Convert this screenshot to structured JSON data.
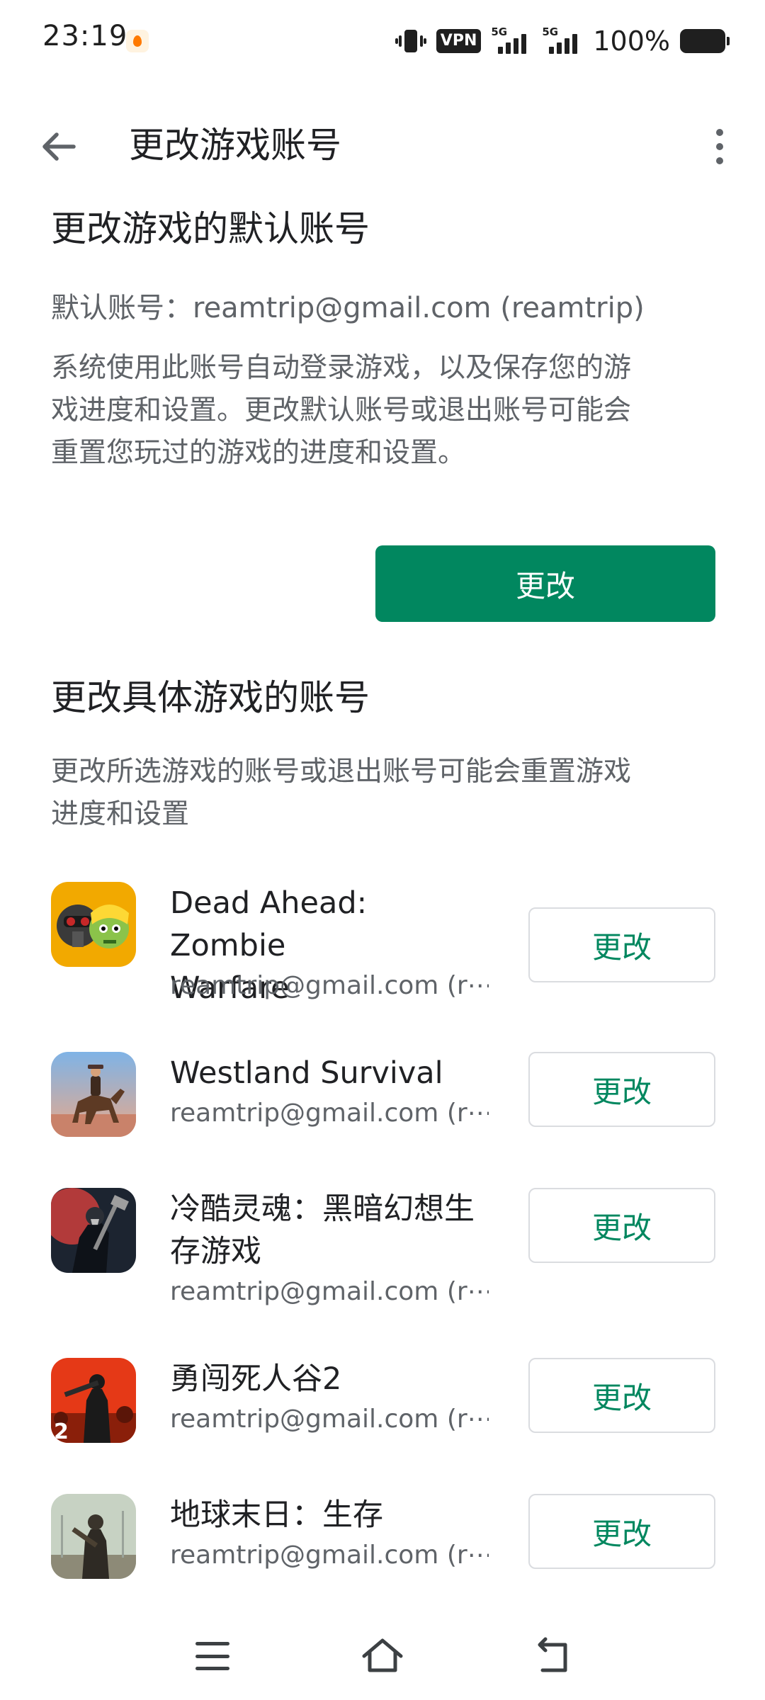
{
  "status_bar": {
    "time": "23:19",
    "vpn": "VPN",
    "network1": "5G",
    "network2": "5G",
    "battery": "100%"
  },
  "app_bar": {
    "title": "更改游戏账号"
  },
  "default_section": {
    "title": "更改游戏的默认账号",
    "account_line": "默认账号：reamtrip@gmail.com (reamtrip)",
    "description_lines": [
      "系统使用此账号自动登录游戏，以及保存您的游",
      "戏进度和设置。更改默认账号或退出账号可能会",
      "重置您玩过的游戏的进度和设置。"
    ],
    "change_button": "更改"
  },
  "specific_section": {
    "title": "更改具体游戏的账号",
    "description_lines": [
      "更改所选游戏的账号或退出账号可能会重置游戏",
      "进度和设置"
    ]
  },
  "games": [
    {
      "name_lines": [
        "Dead Ahead: Zombie",
        "Warfare"
      ],
      "account": "reamtrip@gmail.com (r⋯",
      "button": "更改",
      "icon": "dead-ahead-icon"
    },
    {
      "name_lines": [
        "Westland Survival"
      ],
      "account": "reamtrip@gmail.com (r⋯",
      "button": "更改",
      "icon": "westland-survival-icon"
    },
    {
      "name_lines": [
        "冷酷灵魂：黑暗幻想生",
        "存游戏"
      ],
      "account": "reamtrip@gmail.com (r⋯",
      "button": "更改",
      "icon": "grim-soul-icon"
    },
    {
      "name_lines": [
        "勇闯死人谷2"
      ],
      "account": "reamtrip@gmail.com (r⋯",
      "button": "更改",
      "icon": "into-the-dead-2-icon"
    },
    {
      "name_lines": [
        "地球末日：生存"
      ],
      "account": "reamtrip@gmail.com (r⋯",
      "button": "更改",
      "icon": "last-day-on-earth-icon"
    }
  ],
  "colors": {
    "accent": "#01875f",
    "text_primary": "#202124",
    "text_secondary": "#5f6368",
    "button_border": "#dadce0"
  },
  "nav_bar": {
    "icons": [
      "menu-icon",
      "home-icon",
      "back-icon"
    ]
  }
}
